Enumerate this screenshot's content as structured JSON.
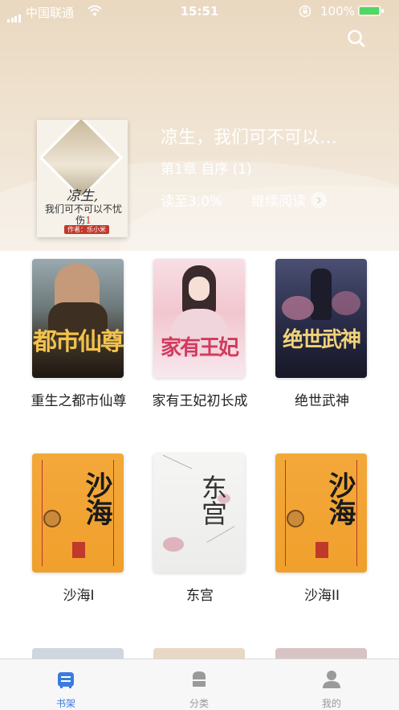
{
  "status_bar": {
    "carrier": "中国联通",
    "time": "15:51",
    "battery": "100%"
  },
  "header": {
    "search_icon": "search-icon"
  },
  "recent_book": {
    "cover_title": "凉生,",
    "cover_subtitle": "我们可不可以不忧伤",
    "cover_subtitle_number": "1",
    "cover_author": "作者：乐小米",
    "title": "凉生，我们可不可以…",
    "chapter": "第1章 自序 (1)",
    "progress": "读至3.0%",
    "continue_label": "继续阅读"
  },
  "books": [
    {
      "title": "重生之都市仙尊",
      "cover_text": "都市仙尊"
    },
    {
      "title": "家有王妃初长成",
      "cover_text": "家有王妃"
    },
    {
      "title": "绝世武神",
      "cover_text": "绝世武神"
    },
    {
      "title": "沙海I",
      "cover_text": "沙海"
    },
    {
      "title": "东宫",
      "cover_text": "东宫"
    },
    {
      "title": "沙海II",
      "cover_text": "沙海"
    }
  ],
  "tabbar": {
    "items": [
      {
        "label": "书架",
        "icon": "bookshelf-icon",
        "active": true
      },
      {
        "label": "分类",
        "icon": "category-icon",
        "active": false
      },
      {
        "label": "我的",
        "icon": "profile-icon",
        "active": false
      }
    ],
    "active_color": "#3a7be0",
    "inactive_color": "#9a9a9a"
  }
}
